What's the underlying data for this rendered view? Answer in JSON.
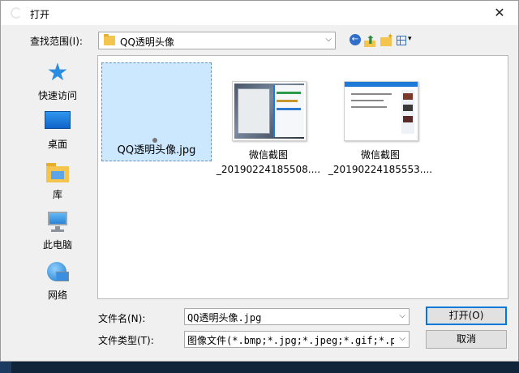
{
  "window": {
    "title": "打开",
    "close_glyph": "✕"
  },
  "toolbar": {
    "lookin_label": "查找范围(I):",
    "lookin_value": "QQ透明头像",
    "dropdown_glyph": "⌵",
    "back_glyph": "←",
    "up_glyph": "⬆",
    "view_dropdown_glyph": "▾"
  },
  "places": [
    {
      "label": "快速访问",
      "icon": "star-icon"
    },
    {
      "label": "桌面",
      "icon": "desktop-icon"
    },
    {
      "label": "库",
      "icon": "library-icon"
    },
    {
      "label": "此电脑",
      "icon": "computer-icon"
    },
    {
      "label": "网络",
      "icon": "network-icon"
    }
  ],
  "files": [
    {
      "line1": "QQ透明头像.jpg",
      "line2": "",
      "selected": true
    },
    {
      "line1": "微信截图",
      "line2": "_20190224185508....",
      "selected": false
    },
    {
      "line1": "微信截图",
      "line2": "_20190224185553....",
      "selected": false
    }
  ],
  "bottom": {
    "filename_label": "文件名(N):",
    "filename_value": "QQ透明头像.jpg",
    "filetype_label": "文件类型(T):",
    "filetype_value": "图像文件(*.bmp;*.jpg;*.jpeg;*.gif;*.pn",
    "open_label": "打开(O)",
    "cancel_label": "取消"
  },
  "colors": {
    "selection": "#cce8ff",
    "accent": "#0078d7",
    "folder": "#f3c54f"
  }
}
